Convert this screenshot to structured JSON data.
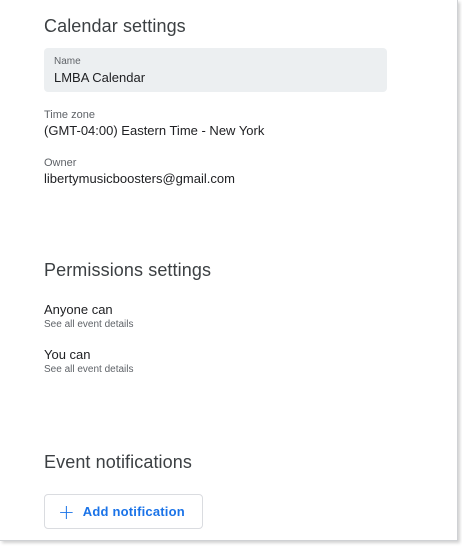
{
  "calendar_settings": {
    "title": "Calendar settings",
    "name_label": "Name",
    "name_value": "LMBA Calendar",
    "timezone_label": "Time zone",
    "timezone_value": "(GMT-04:00) Eastern Time - New York",
    "owner_label": "Owner",
    "owner_value": "libertymusicboosters@gmail.com"
  },
  "permissions": {
    "title": "Permissions settings",
    "items": [
      {
        "title": "Anyone can",
        "desc": "See all event details"
      },
      {
        "title": "You can",
        "desc": "See all event details"
      }
    ]
  },
  "notifications": {
    "title": "Event notifications",
    "add_icon": "plus-icon",
    "add_label": "Add notification"
  },
  "colors": {
    "accent": "#1a73e8",
    "field_bg": "#eceff1"
  }
}
